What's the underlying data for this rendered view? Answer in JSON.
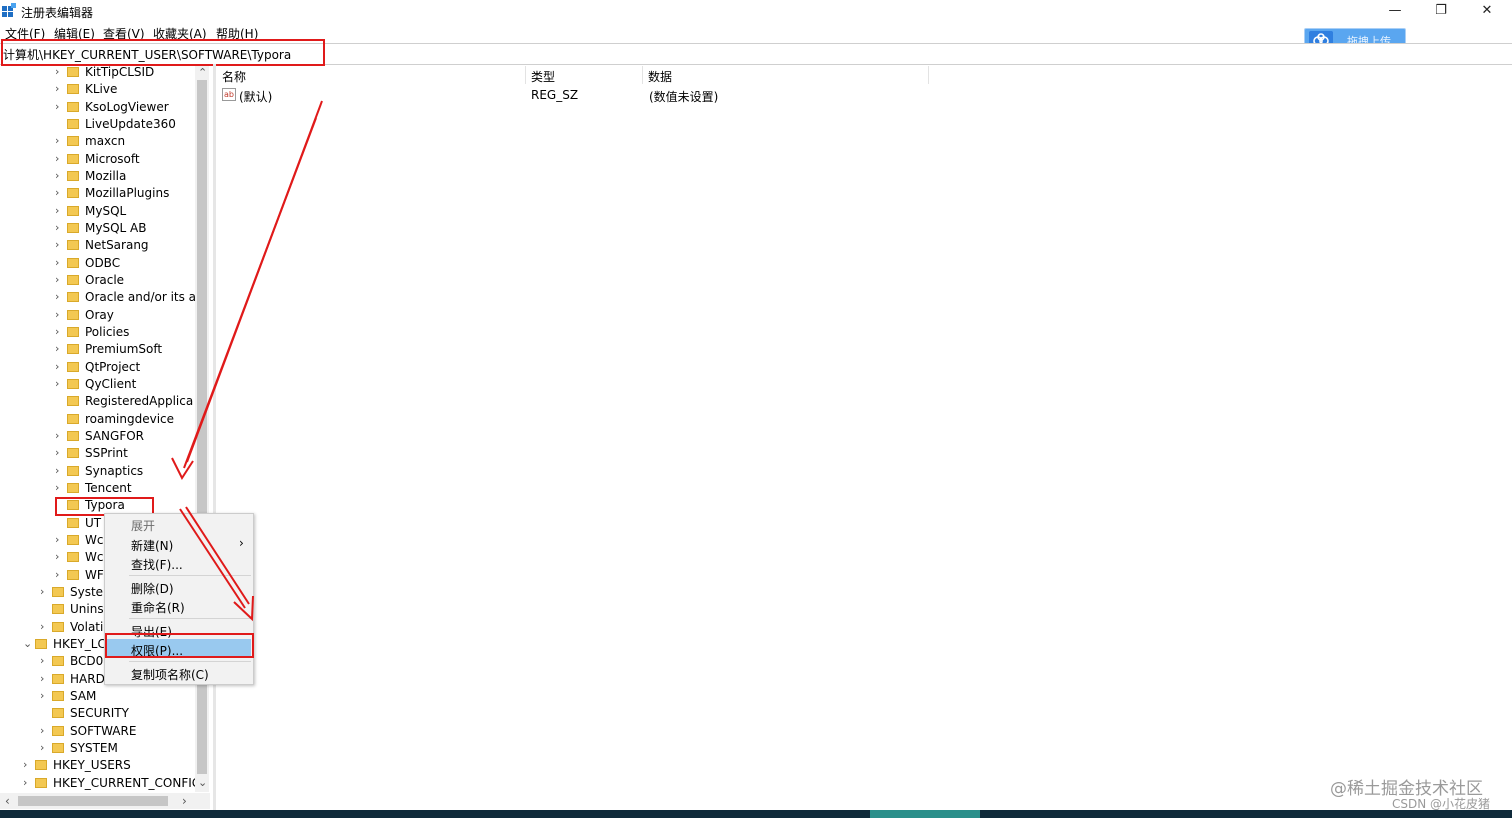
{
  "window": {
    "title": "注册表编辑器",
    "minimize": "—",
    "maximize": "❐",
    "close": "✕"
  },
  "menu": [
    "文件(F)",
    "编辑(E)",
    "查看(V)",
    "收藏夹(A)",
    "帮助(H)"
  ],
  "address": {
    "path": "计算机\\HKEY_CURRENT_USER\\SOFTWARE\\Typora"
  },
  "upload_button": {
    "label": "拖拽上传"
  },
  "tree": [
    {
      "label": "KitTipCLSID",
      "chev": "›"
    },
    {
      "label": "KLive",
      "chev": "›"
    },
    {
      "label": "KsoLogViewer",
      "chev": "›"
    },
    {
      "label": "LiveUpdate360",
      "chev": ""
    },
    {
      "label": "maxcn",
      "chev": "›"
    },
    {
      "label": "Microsoft",
      "chev": "›"
    },
    {
      "label": "Mozilla",
      "chev": "›"
    },
    {
      "label": "MozillaPlugins",
      "chev": "›"
    },
    {
      "label": "MySQL",
      "chev": "›"
    },
    {
      "label": "MySQL AB",
      "chev": "›"
    },
    {
      "label": "NetSarang",
      "chev": "›"
    },
    {
      "label": "ODBC",
      "chev": "›"
    },
    {
      "label": "Oracle",
      "chev": "›"
    },
    {
      "label": "Oracle and/or its af",
      "chev": "›"
    },
    {
      "label": "Oray",
      "chev": "›"
    },
    {
      "label": "Policies",
      "chev": "›"
    },
    {
      "label": "PremiumSoft",
      "chev": "›"
    },
    {
      "label": "QtProject",
      "chev": "›"
    },
    {
      "label": "QyClient",
      "chev": "›"
    },
    {
      "label": "RegisteredApplica",
      "chev": ""
    },
    {
      "label": "roamingdevice",
      "chev": ""
    },
    {
      "label": "SANGFOR",
      "chev": "›"
    },
    {
      "label": "SSPrint",
      "chev": "›"
    },
    {
      "label": "Synaptics",
      "chev": "›"
    },
    {
      "label": "Tencent",
      "chev": "›"
    },
    {
      "label": "Typora",
      "chev": ""
    },
    {
      "label": "UT",
      "chev": ""
    },
    {
      "label": "Wc",
      "chev": "›"
    },
    {
      "label": "Wc",
      "chev": "›"
    },
    {
      "label": "WF",
      "chev": "›"
    },
    {
      "label": "Syste",
      "chev": "›"
    },
    {
      "label": "Unins",
      "chev": ""
    },
    {
      "label": "Volati",
      "chev": "›"
    },
    {
      "label": "HKEY_LC",
      "chev": "⌄"
    },
    {
      "label": "BCD0",
      "chev": "›"
    },
    {
      "label": "HARD",
      "chev": "›"
    },
    {
      "label": "SAM",
      "chev": "›"
    },
    {
      "label": "SECURITY",
      "chev": ""
    },
    {
      "label": "SOFTWARE",
      "chev": "›"
    },
    {
      "label": "SYSTEM",
      "chev": "›"
    },
    {
      "label": "HKEY_USERS",
      "chev": "›"
    },
    {
      "label": "HKEY_CURRENT_CONFIG",
      "chev": "›"
    }
  ],
  "columns": {
    "name": "名称",
    "type": "类型",
    "data": "数据"
  },
  "values": [
    {
      "icon": "ab",
      "name": "(默认)",
      "type": "REG_SZ",
      "data": "(数值未设置)"
    }
  ],
  "context_menu": {
    "items": [
      {
        "label": "展开",
        "greyed": true
      },
      {
        "label": "新建(N)",
        "submenu": "›"
      },
      {
        "label": "查找(F)..."
      },
      {
        "label": "删除(D)"
      },
      {
        "label": "重命名(R)"
      },
      {
        "label": "导出(E)"
      },
      {
        "label": "权限(P)...",
        "selected": true
      },
      {
        "label": "复制项名称(C)"
      }
    ]
  },
  "scroll_arrows": {
    "up": "⌃",
    "down": "⌄",
    "left": "‹",
    "right": "›"
  },
  "watermark": {
    "line1": "@稀土掘金技术社区",
    "line2": "CSDN @小花皮猪"
  },
  "colors": {
    "highlight_red": "#e01a1a",
    "selection_blue": "#99c9ef",
    "folder_yellow": "#f3c852"
  }
}
